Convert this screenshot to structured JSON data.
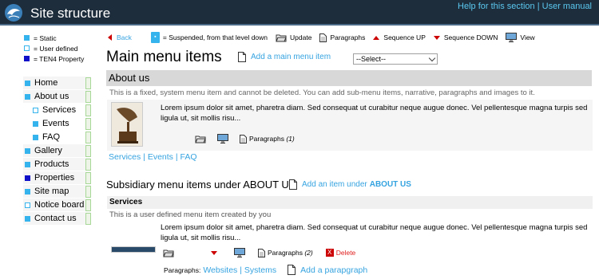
{
  "header": {
    "title": "Site structure",
    "help_link": "Help for this section",
    "manual_link": "User manual",
    "separator": "|"
  },
  "legend": {
    "static": "= Static",
    "user_defined": "= User defined",
    "property": "= TEN4 Property"
  },
  "nav": [
    {
      "label": "Home",
      "kind": "static"
    },
    {
      "label": "About us",
      "kind": "static"
    },
    {
      "label": "Services",
      "kind": "user"
    },
    {
      "label": "Events",
      "kind": "static"
    },
    {
      "label": "FAQ",
      "kind": "static"
    },
    {
      "label": "Gallery",
      "kind": "static"
    },
    {
      "label": "Products",
      "kind": "static"
    },
    {
      "label": "Properties",
      "kind": "property"
    },
    {
      "label": "Site map",
      "kind": "static"
    },
    {
      "label": "Notice board",
      "kind": "user"
    },
    {
      "label": "Contact us",
      "kind": "static"
    }
  ],
  "toolbar": {
    "back": "Back",
    "suspended": "= Suspended, from that level down",
    "update": "Update",
    "paragraphs": "Paragraphs",
    "sequence_up": "Sequence UP",
    "sequence_down": "Sequence DOWN",
    "view": "View"
  },
  "main": {
    "title": "Main menu items",
    "add_link": "Add a main menu item",
    "select_value": "--Select--"
  },
  "about": {
    "heading": "About us",
    "note": "This is a fixed, system menu item and cannot be deleted. You can add sub-menu items, narrative, paragraphs and images to it.",
    "lorem": "Lorem ipsum dolor sit amet, pharetra diam. Sed consequat ut curabitur neque augue donec. Vel pellentesque magna turpis sed ligula ut, sit mollis risu...",
    "paragraphs_label": "Paragraphs",
    "paragraphs_count": "(1)",
    "sub_links": [
      "Services",
      "Events",
      "FAQ"
    ]
  },
  "subsidiary": {
    "title": "Subsidiary menu items under ABOUT US",
    "add_link": "Add an item under",
    "add_link_target": "ABOUT US"
  },
  "services": {
    "heading": "Services",
    "note": "This is a user defined menu item created by you",
    "lorem": "Lorem ipsum dolor sit amet, pharetra diam. Sed consequat ut curabitur neque augue donec. Vel pellentesque magna turpis sed ligula ut, sit mollis risu...",
    "paragraphs_label": "Paragraphs",
    "paragraphs_count": "(2)",
    "delete_label": "Delete",
    "para_prefix": "Paragraphs:",
    "para_links": [
      "Websites",
      "Systems"
    ],
    "add_para": "Add a parapgraph"
  },
  "colors": {
    "header_bg": "#1e2d3b",
    "link": "#35a3e0",
    "static_square": "#35b3ec",
    "property_square": "#1010c8",
    "red_arrow": "#cc0000"
  }
}
